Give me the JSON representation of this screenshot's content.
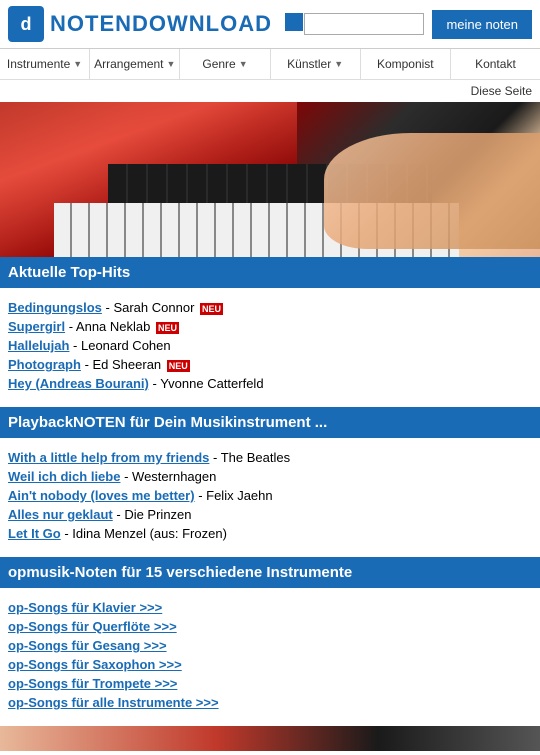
{
  "header": {
    "logo_letter": "d",
    "logo_text": "NOTENDOWNLOAD",
    "search_placeholder": "",
    "meine_noten_label": "meine noten"
  },
  "nav": {
    "items": [
      {
        "label": "Instrumente",
        "has_arrow": true
      },
      {
        "label": "Arrangement",
        "has_arrow": true
      },
      {
        "label": "Genre",
        "has_arrow": true
      },
      {
        "label": "Künstler",
        "has_arrow": true
      },
      {
        "label": "Komponist",
        "has_arrow": false
      },
      {
        "label": "Kontakt",
        "has_arrow": false
      }
    ]
  },
  "diese_seite_text": "Diese Seite",
  "sections": {
    "top_hits": {
      "header": "Aktuelle Top-Hits",
      "items": [
        {
          "title": "Bedingungslos",
          "artist": "Sarah Connor",
          "new": true
        },
        {
          "title": "Supergirl",
          "artist": "Anna Neklab",
          "new": true
        },
        {
          "title": "Hallelujah",
          "artist": "Leonard Cohen",
          "new": false
        },
        {
          "title": "Photograph",
          "artist": "Ed Sheeran",
          "new": true
        },
        {
          "title": "Hey (Andreas Bourani)",
          "artist": "Yvonne Catterfeld",
          "new": false
        }
      ],
      "new_label": "NEU"
    },
    "playback": {
      "header": "PlaybackNOTEN für Dein Musikinstrument ...",
      "items": [
        {
          "title": "With a little help from my friends",
          "artist": "The Beatles"
        },
        {
          "title": "Weil ich dich liebe",
          "artist": "Westernhagen"
        },
        {
          "title": "Ain't nobody (loves me better)",
          "artist": "Felix Jaehn"
        },
        {
          "title": "Alles nur geklaut",
          "artist": "Die Prinzen"
        },
        {
          "title": "Let It Go",
          "artist": "Idina Menzel (aus: Frozen)"
        }
      ]
    },
    "instrumente": {
      "header": "opmusik-Noten für 15 verschiedene Instrumente",
      "items": [
        {
          "label": "op-Songs für Klavier >>>"
        },
        {
          "label": "op-Songs für Querflöte >>>"
        },
        {
          "label": "op-Songs für Gesang >>>"
        },
        {
          "label": "op-Songs für Saxophon >>>"
        },
        {
          "label": "op-Songs für Trompete >>>"
        },
        {
          "label": "op-Songs für alle Instrumente >>>"
        }
      ]
    }
  }
}
